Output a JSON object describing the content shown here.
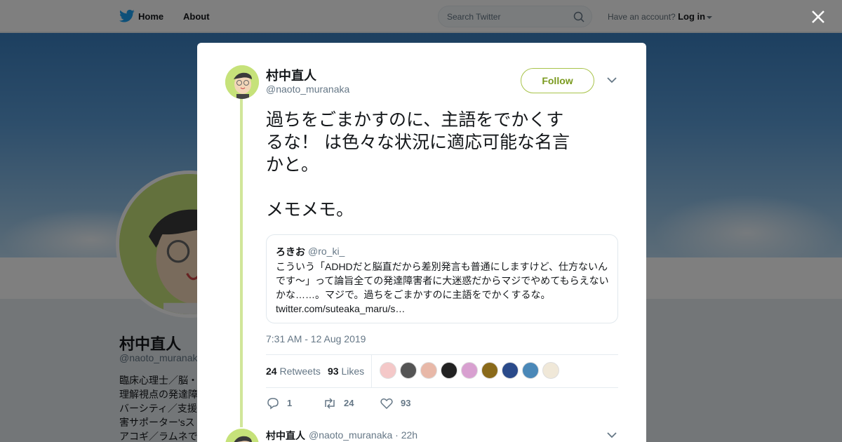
{
  "nav": {
    "home_label": "Home",
    "about_label": "About",
    "search_placeholder": "Search Twitter",
    "account_prompt": "Have an account?",
    "login_label": "Log in"
  },
  "background_profile": {
    "name": "村中直人",
    "handle": "@naoto_muranaka",
    "bio": "臨床心理士／脳・\n理解視点の発達障\nバーシティ／支援\n害サポーター'sス\nアコギ／ラムネで"
  },
  "tweet": {
    "author_name": "村中直人",
    "author_handle": "@naoto_muranaka",
    "follow_label": "Follow",
    "text_lines": [
      "過ちをごまかすのに、主語をでかくす",
      "るな！ は色々な状況に適応可能な名言",
      "かと。",
      "メモメモ。"
    ],
    "quote": {
      "name": "ろきお",
      "handle": "@ro_ki_",
      "text": "こういう「ADHDだと脳直だから差別発言も普通にしますけど、仕方ないんです～」って論旨全ての発達障害者に大迷惑だからマジでやめてもらえないかな……。マジで。過ちをごまかすのに主語をでかくするな。",
      "link": "twitter.com/suteaka_maru/s…"
    },
    "timestamp": "7:31 AM - 12 Aug 2019",
    "retweets_count": "24",
    "retweets_label": "Retweets",
    "likes_count": "93",
    "likes_label": "Likes",
    "actions": {
      "replies": "1",
      "retweets": "24",
      "likes": "93"
    }
  },
  "reply": {
    "author_name": "村中直人",
    "handle_time": "@naoto_muranaka · 22h"
  },
  "colors": {
    "follow_green": "#7a9a1e",
    "thread_line": "#d1e69a",
    "avatar_bg": "#c6e27a",
    "twitter_blue": "#1da1f2"
  },
  "liker_avatar_colors": [
    "#f4c8c8",
    "#555555",
    "#e8b8a8",
    "#222222",
    "#d8a0d0",
    "#8a6a1a",
    "#2a4a8a",
    "#4a88b8",
    "#f0e8d8"
  ]
}
